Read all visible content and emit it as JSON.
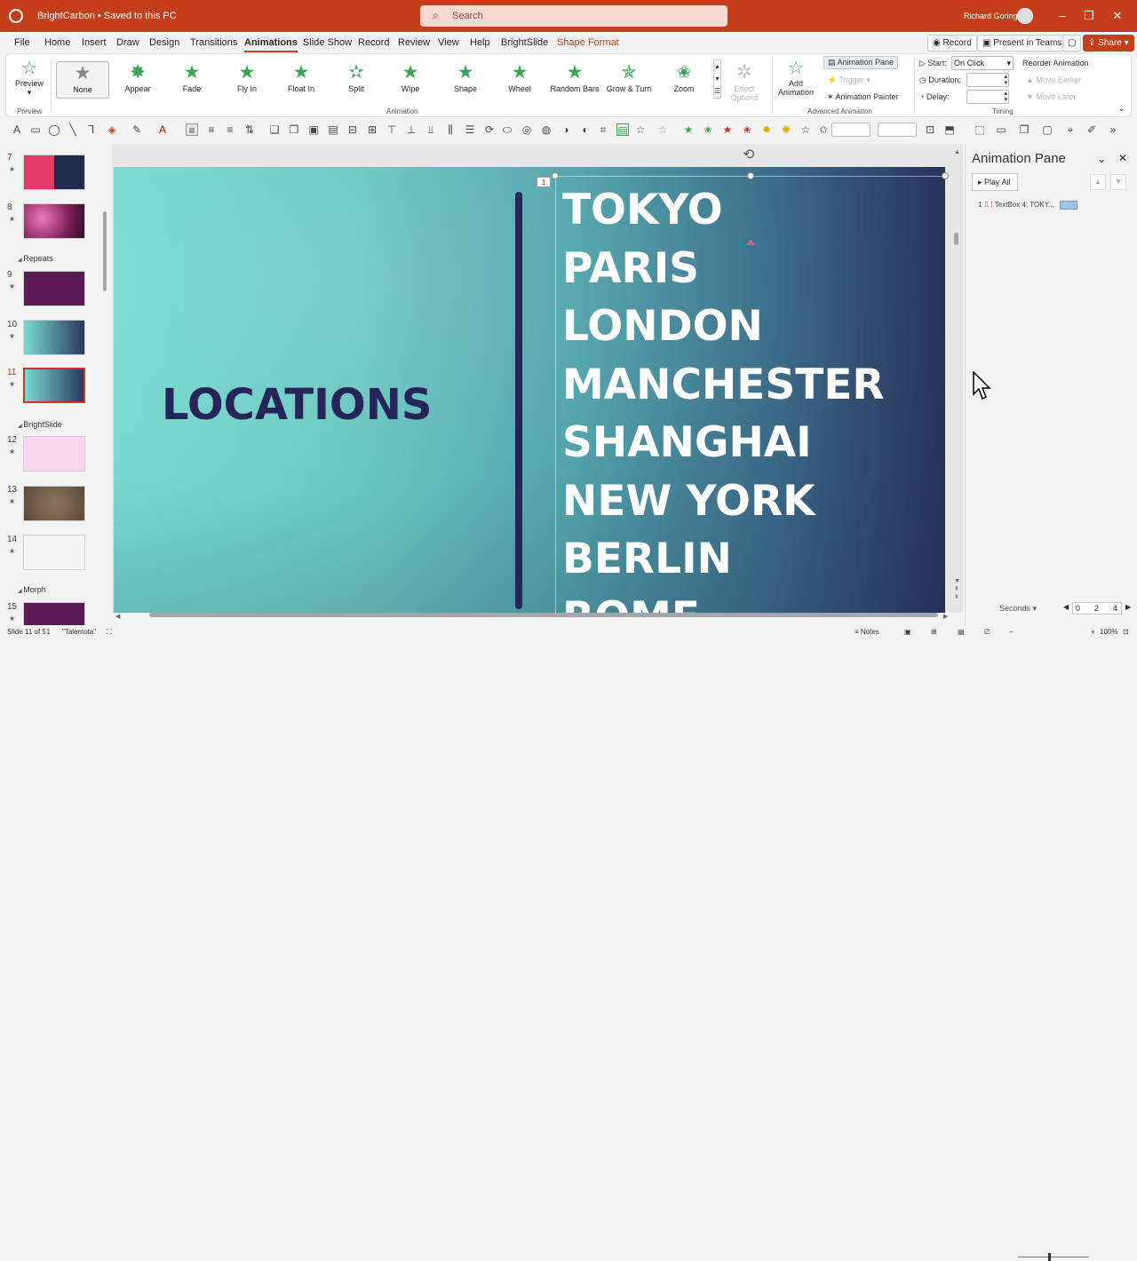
{
  "titlebar": {
    "doc_title": "BrightCarbon • Saved to this PC",
    "search_placeholder": "Search",
    "user_name": "Richard Goring"
  },
  "menu": {
    "tabs": [
      "File",
      "Home",
      "Insert",
      "Draw",
      "Design",
      "Transitions",
      "Animations",
      "Slide Show",
      "Record",
      "Review",
      "View",
      "Help",
      "BrightSlide",
      "Shape Format"
    ],
    "active": "Animations",
    "record_label": "Record",
    "teams_label": "Present in Teams",
    "share_label": "Share"
  },
  "ribbon": {
    "preview_label": "Preview",
    "preview_group": "Preview",
    "animation_group": "Animation",
    "advanced_group": "Advanced Animation",
    "timing_group": "Timing",
    "gallery": [
      "None",
      "Appear",
      "Fade",
      "Fly In",
      "Float In",
      "Split",
      "Wipe",
      "Shape",
      "Wheel",
      "Random Bars",
      "Grow & Turn",
      "Zoom"
    ],
    "effect_options": "Effect Options",
    "add_animation": "Add Animation",
    "animation_pane_btn": "Animation Pane",
    "trigger": "Trigger",
    "animation_painter": "Animation Painter",
    "start_label": "Start:",
    "start_value": "On Click",
    "duration_label": "Duration:",
    "delay_label": "Delay:",
    "reorder_label": "Reorder Animation",
    "move_earlier": "Move Earlier",
    "move_later": "Move Later"
  },
  "thumbnails": {
    "sections": [
      "Repeats",
      "BrightSlide",
      "Morph"
    ],
    "slides": [
      "7",
      "8",
      "9",
      "10",
      "11",
      "12",
      "13",
      "14",
      "15"
    ],
    "selected": "11",
    "thumb_title": "LOCATIONS"
  },
  "slide": {
    "title": "LOCATIONS",
    "cities": [
      "TOKYO",
      "PARIS",
      "LONDON",
      "MANCHESTER",
      "SHANGHAI",
      "NEW YORK",
      "BERLIN",
      "ROME"
    ],
    "anim_tag": "1"
  },
  "anim_pane": {
    "title": "Animation Pane",
    "play_all": "Play All",
    "item_index": "1",
    "item_label": "TextBox 4: TOKY...",
    "seconds": "Seconds",
    "ticks": [
      "0",
      "2",
      "4"
    ]
  },
  "status": {
    "slide_info": "Slide 11 of 51",
    "theme": "\"Talentota\"",
    "notes": "Notes",
    "zoom": "100%"
  },
  "colors": {
    "accent": "#c43e1c",
    "slide_title": "#25255a",
    "divider": "#232656"
  }
}
